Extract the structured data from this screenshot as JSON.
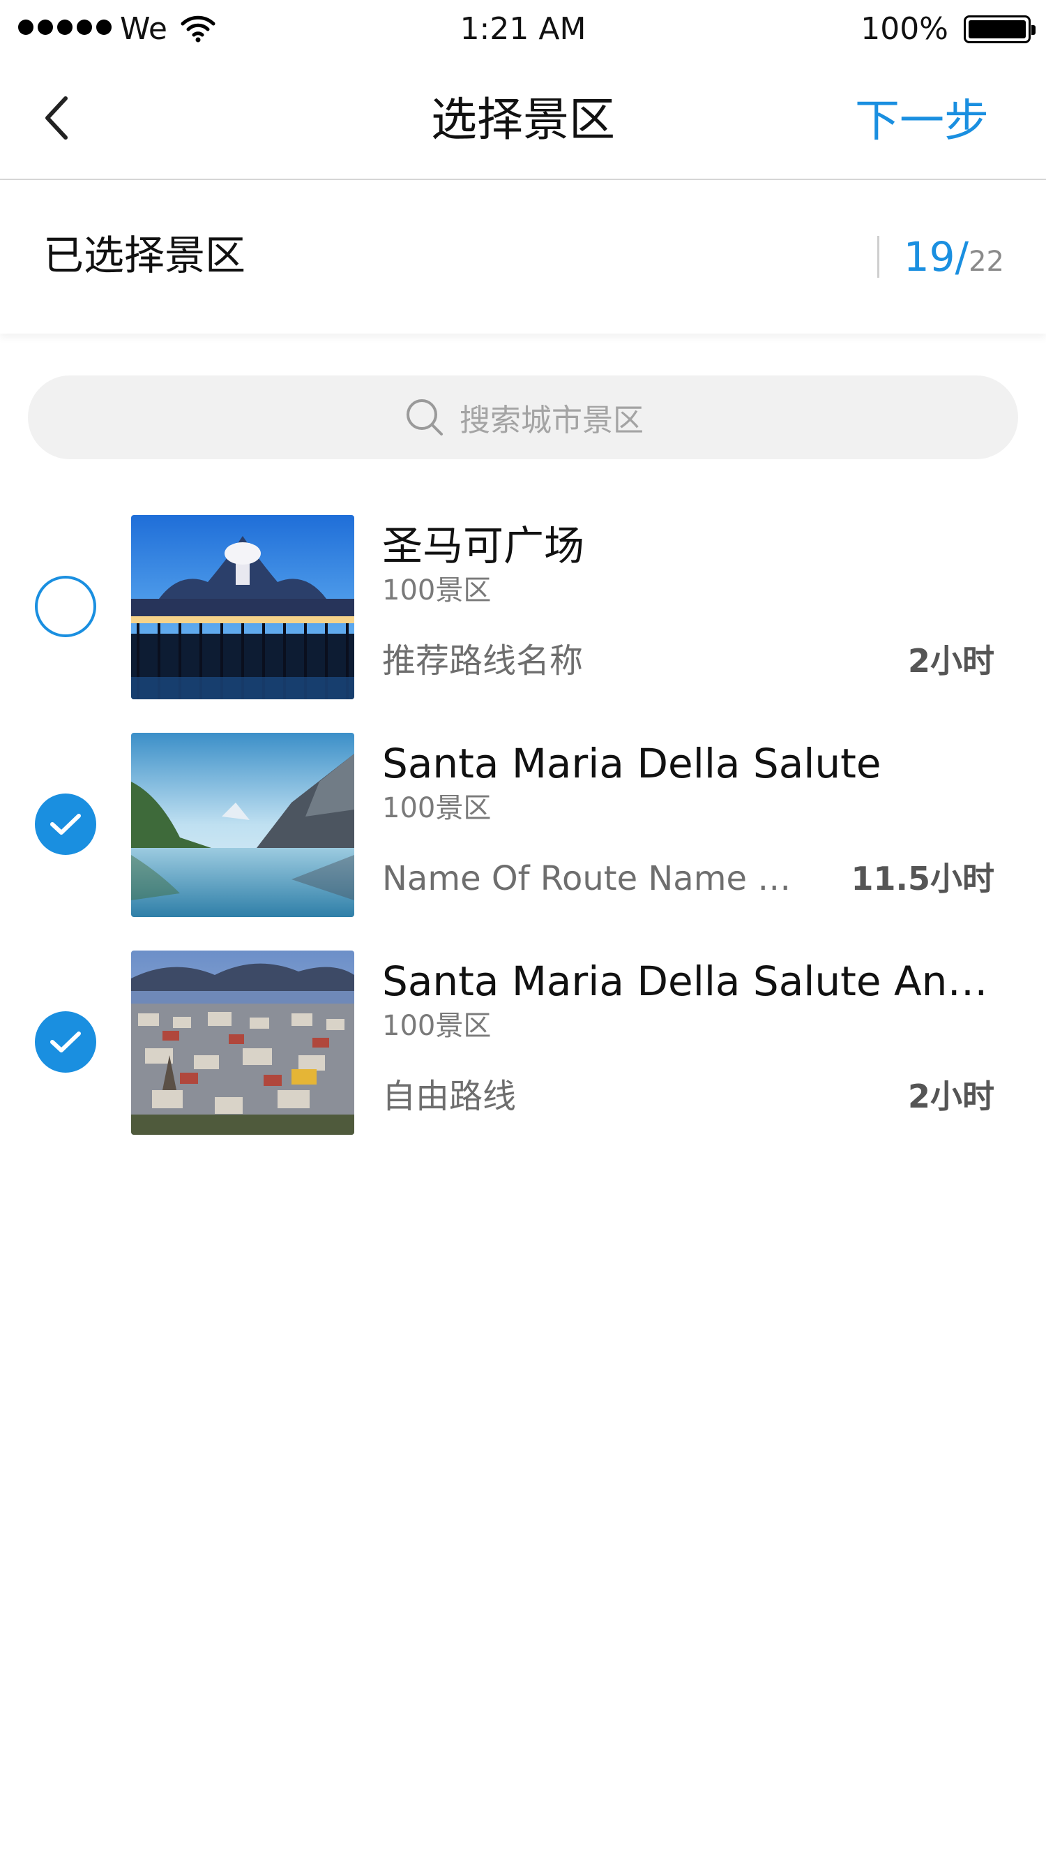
{
  "status_bar": {
    "carrier": "We",
    "time": "1:21 AM",
    "battery": "100%"
  },
  "nav": {
    "title": "选择景区",
    "next_label": "下一步",
    "back_icon": "chevron-left-icon"
  },
  "selected": {
    "label": "已选择景区",
    "count_selected": "19/",
    "count_total": "22"
  },
  "search": {
    "placeholder": "搜索城市景区",
    "icon": "search-icon"
  },
  "items": [
    {
      "title": "圣马可广场",
      "subtitle": "100景区",
      "route": "推荐路线名称",
      "duration": "2小时",
      "checked": false
    },
    {
      "title": "Santa Maria Della Salute",
      "subtitle": "100景区",
      "route": "Name Of Route Name  …",
      "duration": "11.5小时",
      "checked": true
    },
    {
      "title": "Santa Maria Della Salute An…",
      "subtitle": "100景区",
      "route": "自由路线",
      "duration": "2小时",
      "checked": true
    }
  ],
  "colors": {
    "accent": "#1a8fe0",
    "text_primary": "#111111",
    "text_secondary": "#7a7a7a",
    "search_bg": "#f1f1f1"
  }
}
